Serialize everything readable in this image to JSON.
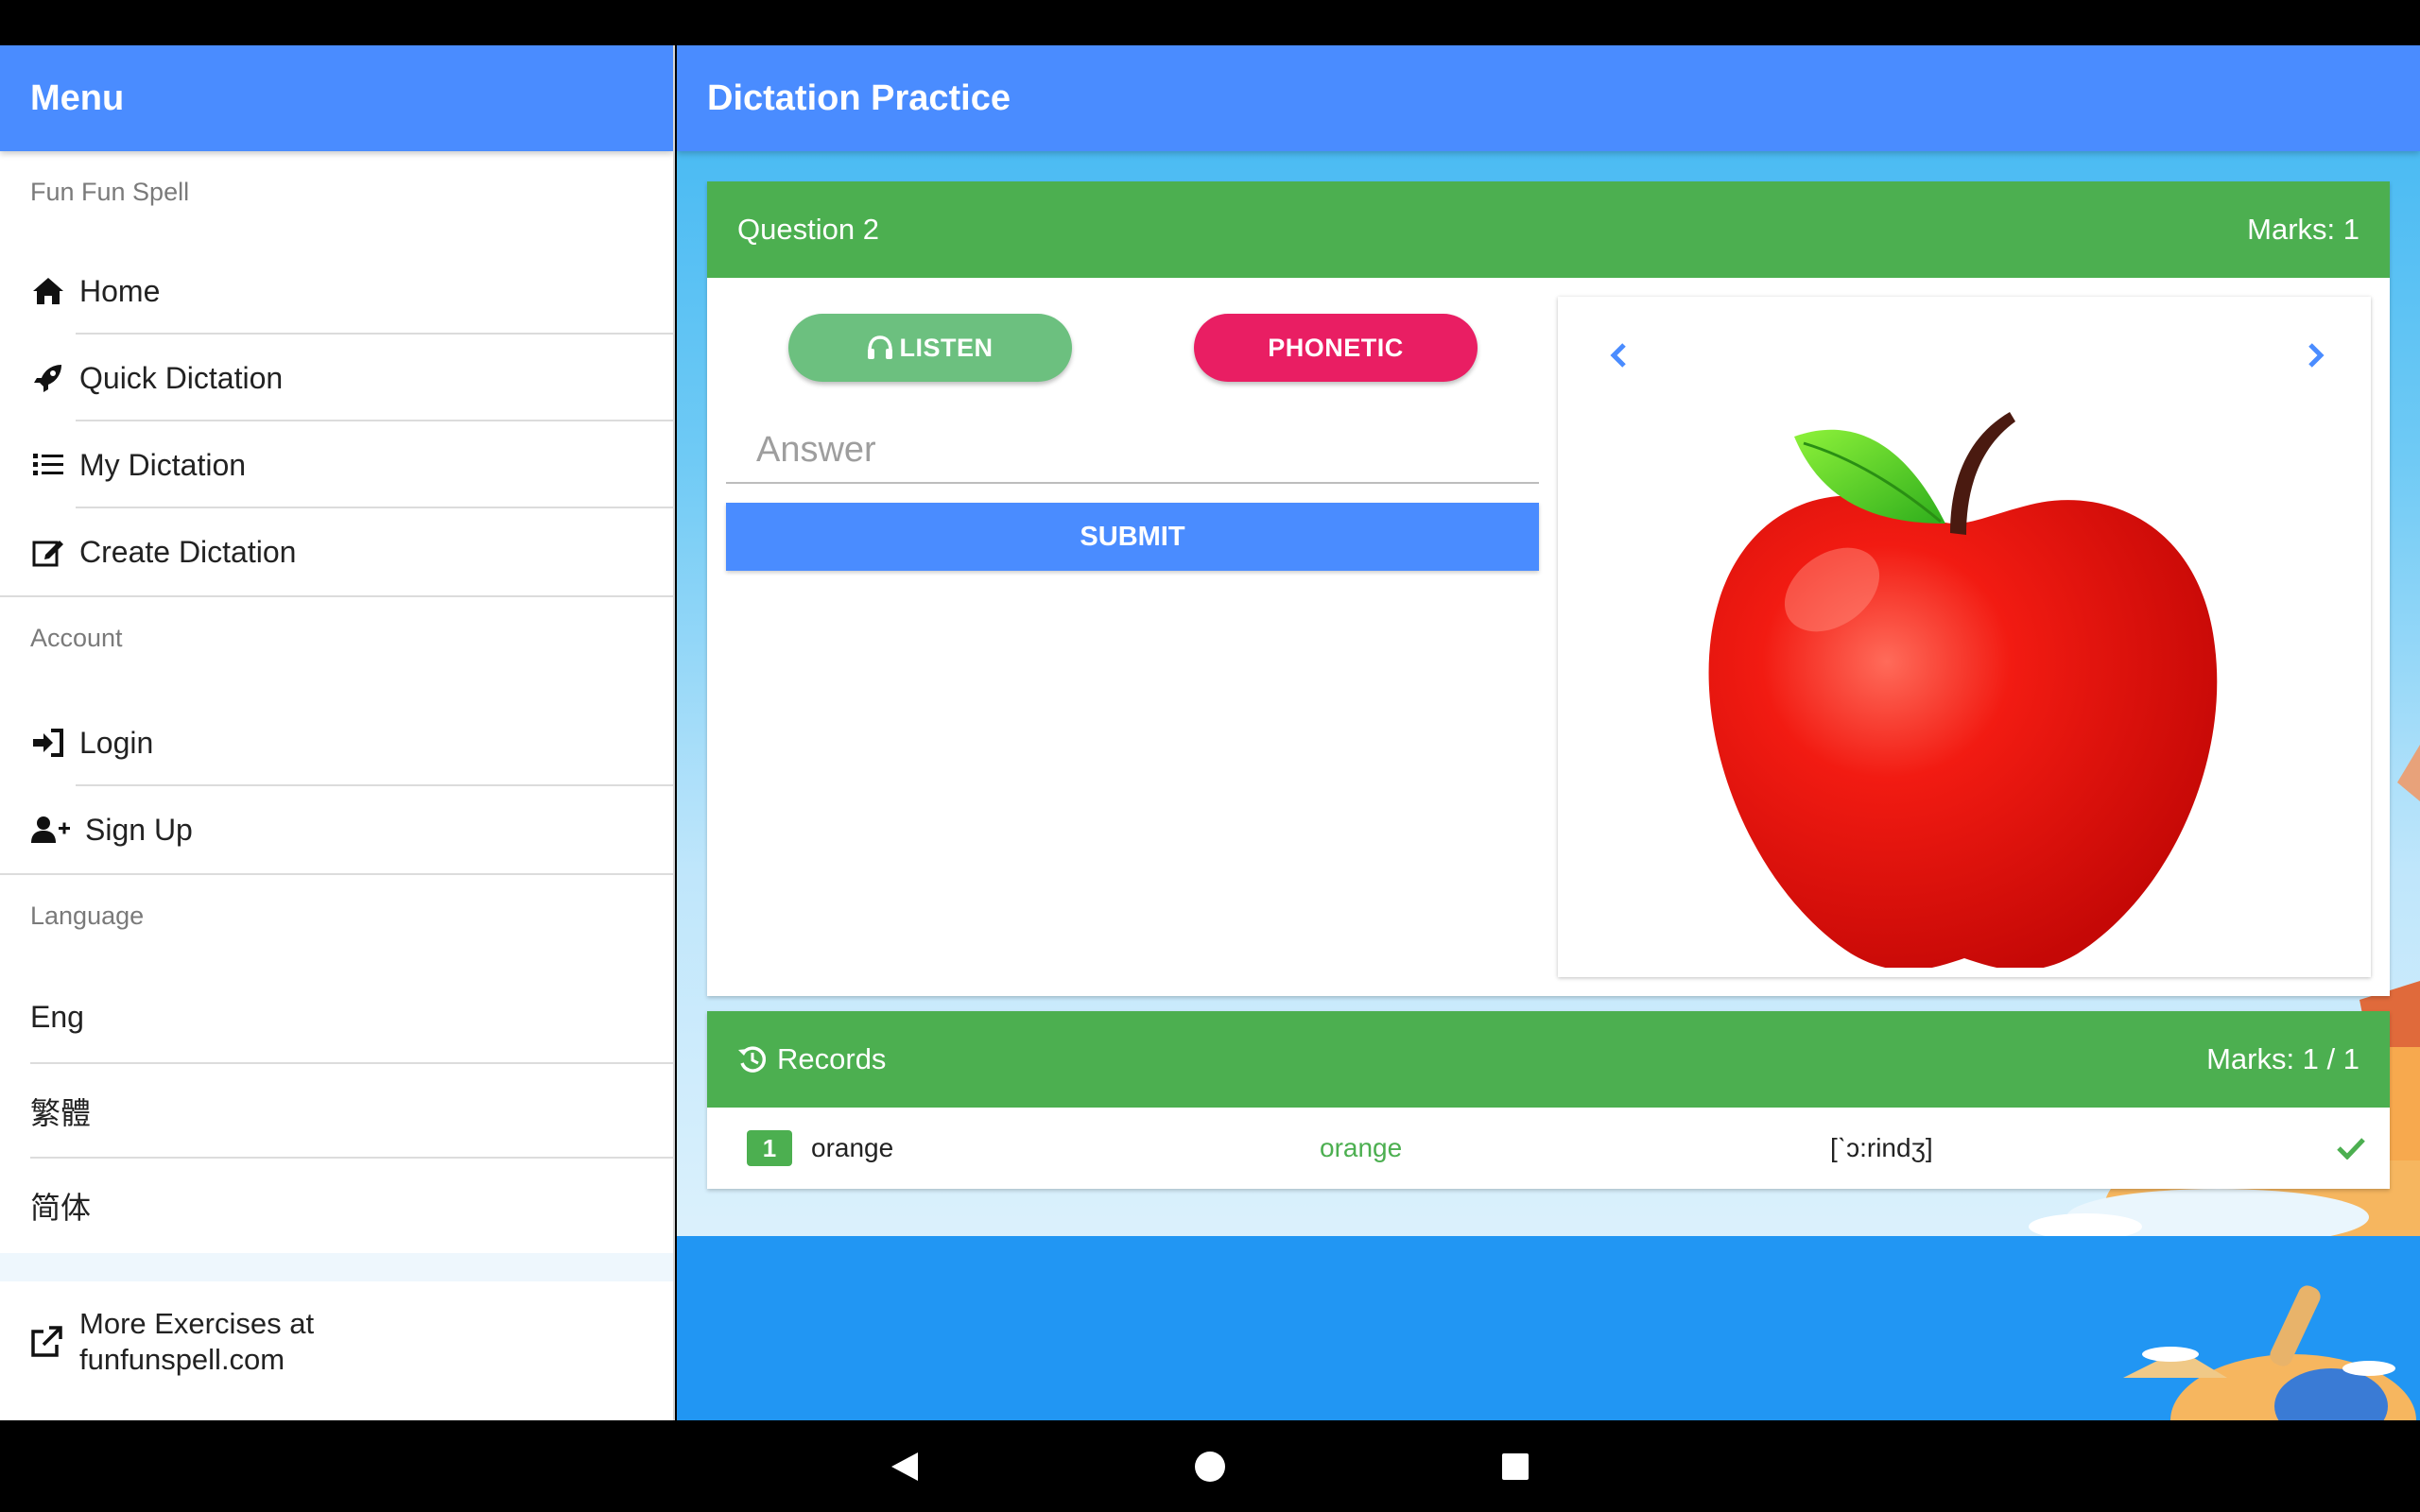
{
  "sidebar": {
    "title": "Menu",
    "app_name": "Fun Fun Spell",
    "main_items": [
      {
        "label": "Home",
        "icon": "home-icon"
      },
      {
        "label": "Quick Dictation",
        "icon": "rocket-icon"
      },
      {
        "label": "My Dictation",
        "icon": "list-icon"
      },
      {
        "label": "Create Dictation",
        "icon": "edit-icon"
      }
    ],
    "account_label": "Account",
    "account_items": [
      {
        "label": "Login",
        "icon": "login-icon"
      },
      {
        "label": "Sign Up",
        "icon": "user-plus-icon"
      }
    ],
    "language_label": "Language",
    "languages": [
      "Eng",
      "繁體",
      "简体"
    ],
    "footer_line1": "More Exercises at",
    "footer_line2": "funfunspell.com"
  },
  "main": {
    "title": "Dictation Practice",
    "question": {
      "label": "Question 2",
      "marks": "Marks: 1",
      "listen_label": "LISTEN",
      "phonetic_label": "PHONETIC",
      "answer_placeholder": "Answer",
      "submit_label": "SUBMIT"
    },
    "records": {
      "title": "Records",
      "marks": "Marks: 1 / 1",
      "rows": [
        {
          "num": "1",
          "answer": "orange",
          "correct": "orange",
          "phonetic": "[ˋɔ:rindʒ]"
        }
      ]
    }
  },
  "colors": {
    "header_blue": "#4a8cff",
    "green": "#4caf50",
    "pink": "#e91e63"
  }
}
